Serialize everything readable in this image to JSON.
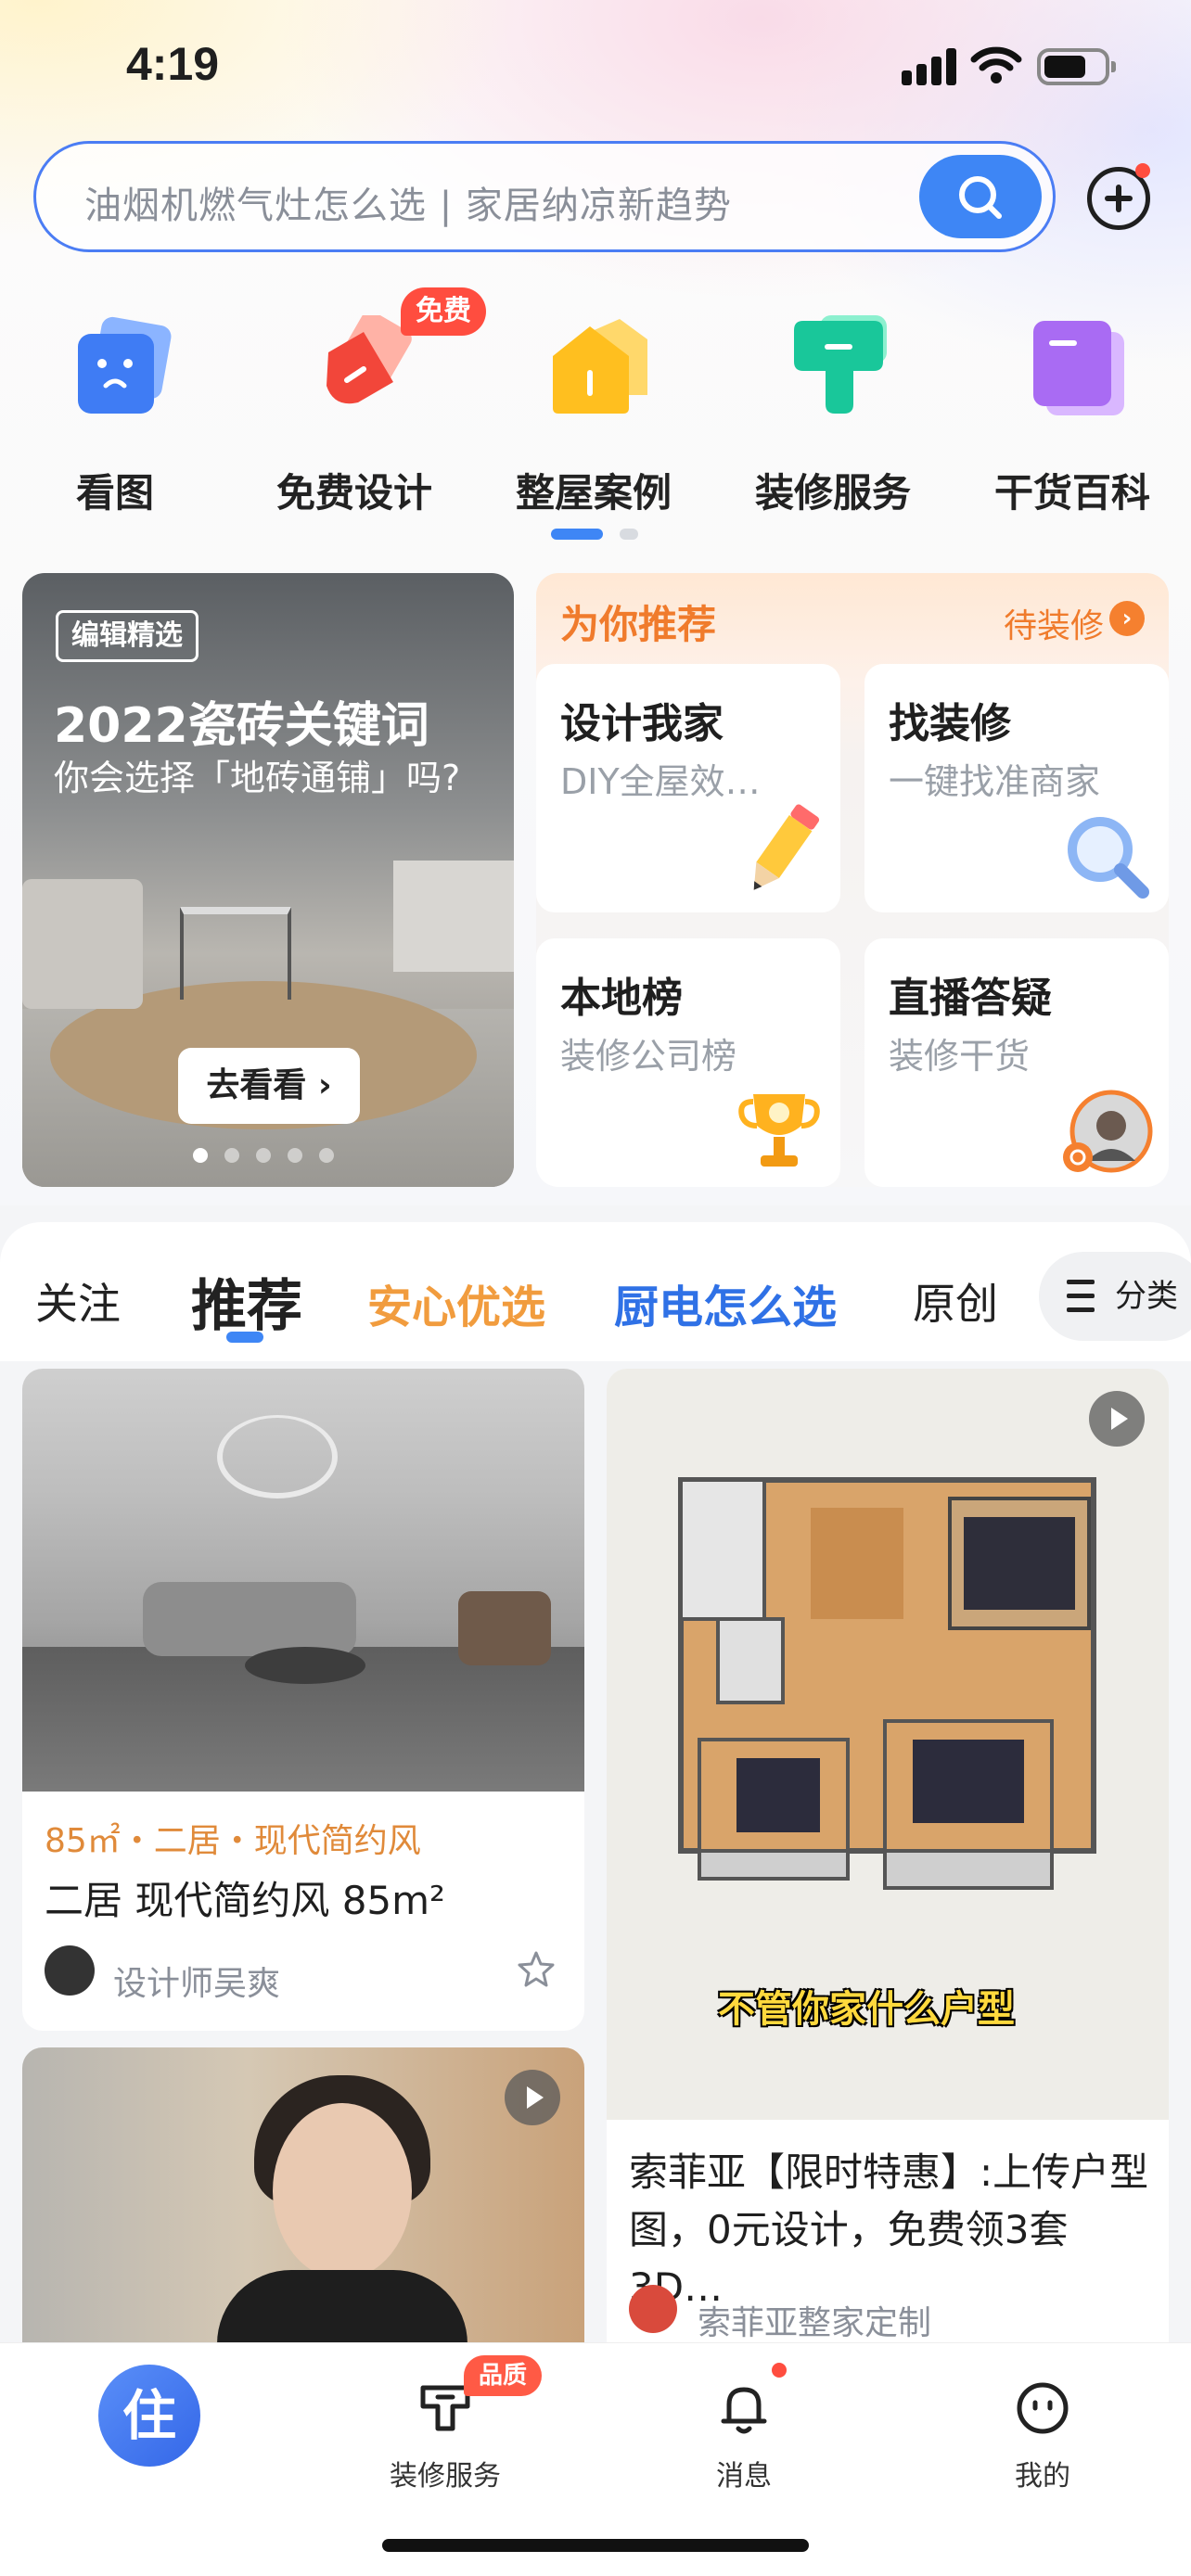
{
  "status_bar": {
    "time": "4:19"
  },
  "search": {
    "placeholder": "油烟机燃气灶怎么选 | 家居纳凉新趋势"
  },
  "categories": [
    {
      "label": "看图",
      "icon": "view-pictures-icon"
    },
    {
      "label": "免费设计",
      "icon": "free-design-icon",
      "badge": "免费"
    },
    {
      "label": "整屋案例",
      "icon": "house-case-icon"
    },
    {
      "label": "装修服务",
      "icon": "renovation-service-icon"
    },
    {
      "label": "干货百科",
      "icon": "encyclopedia-icon"
    }
  ],
  "feature_banner": {
    "tag": "编辑精选",
    "title": "2022瓷砖关键词",
    "subtitle": "你会选择「地砖通铺」吗?",
    "button": "去看看 ›"
  },
  "recommend": {
    "title": "为你推荐",
    "more": "待装修",
    "cards": [
      {
        "title": "设计我家",
        "sub": "DIY全屋效…",
        "icon": "pencil-icon"
      },
      {
        "title": "找装修",
        "sub": "一键找准商家",
        "icon": "magnifier-icon"
      },
      {
        "title": "本地榜",
        "sub": "装修公司榜",
        "icon": "trophy-icon"
      },
      {
        "title": "直播答疑",
        "sub": "装修干货",
        "icon": "live-avatar-icon"
      }
    ]
  },
  "feed_tabs": {
    "follow": "关注",
    "recommend": "推荐",
    "preferred": "安心优选",
    "kitchen": "厨电怎么选",
    "original": "原创",
    "classify": "分类"
  },
  "feed": {
    "card1": {
      "tags": "85㎡・二居・现代简约风",
      "title": "二居 现代简约风 85m²",
      "author": "设计师吴爽"
    },
    "card2": {
      "caption": "不管你家什么户型",
      "title": "索菲亚【限时特惠】:上传户型图，0元设计，免费领3套3D…",
      "author": "索菲亚整家定制"
    }
  },
  "bottom_nav": {
    "home": "住",
    "service": "装修服务",
    "service_badge": "品质",
    "messages": "消息",
    "mine": "我的"
  },
  "colors": {
    "accent": "#3e86f5",
    "orange": "#f07b2c",
    "red_badge": "#ff4d3f"
  }
}
